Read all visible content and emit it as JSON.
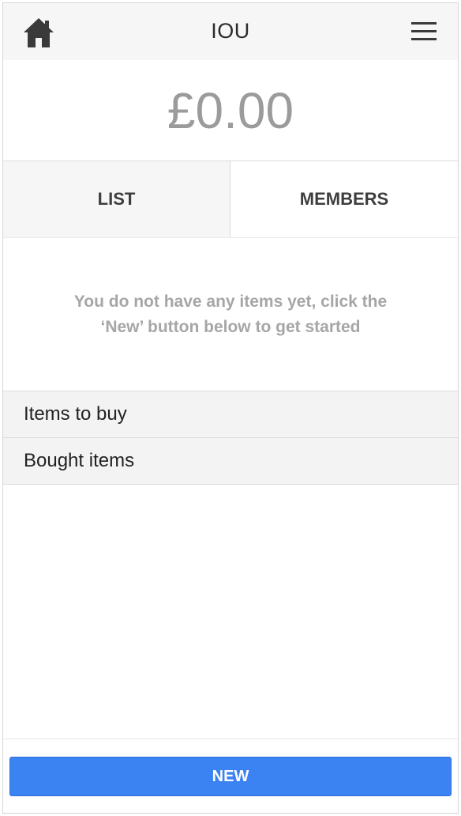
{
  "header": {
    "title": "IOU",
    "home_icon": "home-icon",
    "menu_icon": "hamburger-menu-icon"
  },
  "balance": {
    "amount": "£0.00"
  },
  "tabs": [
    {
      "label": "LIST",
      "active": false
    },
    {
      "label": "MEMBERS",
      "active": true
    }
  ],
  "empty_state": {
    "line1": "You do not have any items yet, click the",
    "line2": "‘New’ button below to get started"
  },
  "sections": [
    {
      "label": "Items to buy"
    },
    {
      "label": "Bought items"
    }
  ],
  "footer": {
    "new_label": "NEW"
  },
  "colors": {
    "accent": "#3b82f2",
    "header_bg": "#f6f6f6",
    "muted_text": "#a6a6a6"
  }
}
